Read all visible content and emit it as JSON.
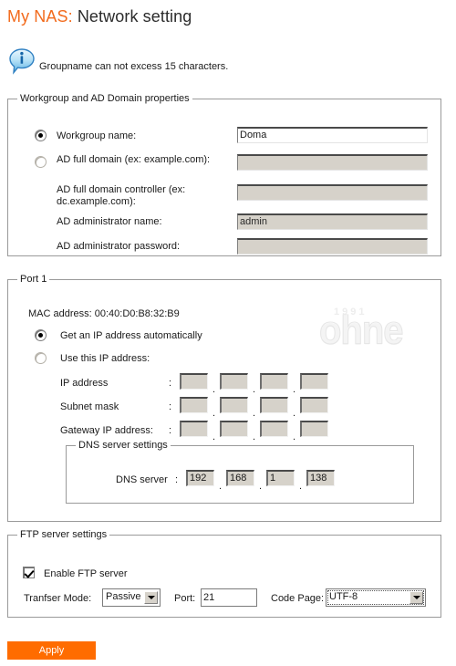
{
  "header": {
    "brand": "My NAS:",
    "title": "Network setting"
  },
  "notice": {
    "icon": "info-bubble-icon",
    "text": "Groupname can not excess 15 characters."
  },
  "workgroup_group": {
    "legend": "Workgroup and AD Domain properties",
    "workgroup_radio_label": "Workgroup name:",
    "workgroup_value": "Doma",
    "ad_radio_label": "AD full domain\n(ex: example.com):",
    "ad_domain_value": "",
    "ad_controller_label": "AD full domain controller\n(ex: dc.example.com):",
    "ad_controller_value": "",
    "ad_admin_name_label": "AD administrator name:",
    "ad_admin_name_value": "admin",
    "ad_admin_password_label": "AD administrator password:",
    "ad_admin_password_value": "",
    "selected": "workgroup"
  },
  "port1_group": {
    "legend": "Port 1",
    "mac_address": "MAC address: 00:40:D0:B8:32:B9",
    "auto_ip_label": "Get an IP address automatically",
    "manual_ip_label": "Use this IP address:",
    "selected": "auto",
    "ip_address_label": "IP address",
    "subnet_mask_label": "Subnet mask",
    "gateway_label": "Gateway IP address:",
    "colon": ":",
    "separator": ".",
    "ip_address_octets": [
      "",
      "",
      "",
      ""
    ],
    "subnet_mask_octets": [
      "",
      "",
      "",
      ""
    ],
    "gateway_octets": [
      "",
      "",
      "",
      ""
    ],
    "dns": {
      "legend": "DNS server settings",
      "label": "DNS server",
      "colon": ":",
      "octets": [
        "192",
        "168",
        "1",
        "138"
      ]
    }
  },
  "ftp_group": {
    "legend": "FTP server settings",
    "enable_label": "Enable FTP server",
    "enabled": true,
    "transfer_mode_label": "Tranfser Mode:",
    "transfer_mode_value": "Passive",
    "port_label": "Port:",
    "port_value": "21",
    "code_page_label": "Code Page:",
    "code_page_value": "UTF-8"
  },
  "footer": {
    "apply_label": "Apply"
  },
  "watermark": {
    "text": "ohne",
    "sub": "1991"
  },
  "colors": {
    "brand_orange": "#f26b1d",
    "apply_orange": "#ff6c00",
    "disabled_field": "#d6d2ca",
    "border_gray": "#9a9a9a"
  }
}
